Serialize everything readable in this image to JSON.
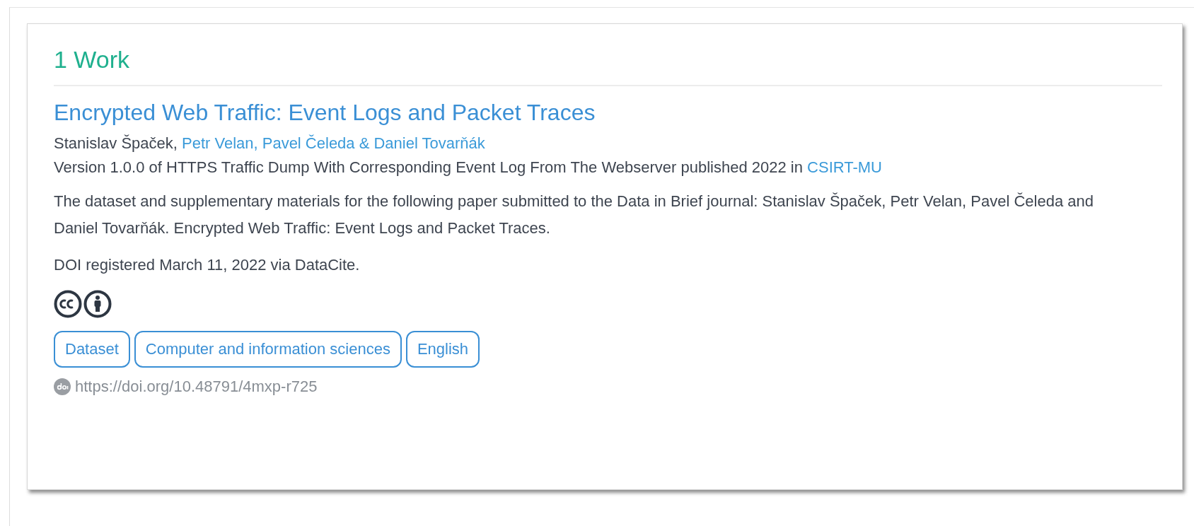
{
  "results_heading": "1 Work",
  "work": {
    "title": "Encrypted Web Traffic: Event Logs and Packet Traces",
    "authors_plain": "Stanislav Špaček,",
    "authors_link": "Petr Velan, Pavel Čeleda & Daniel Tovarňák",
    "version_text": "Version 1.0.0 of HTTPS Traffic Dump With Corresponding Event Log From The Webserver published 2022 in",
    "publisher_link": "CSIRT-MU",
    "description": "The dataset and supplementary materials for the following paper submitted to the Data in Brief journal: Stanislav Špaček, Petr Velan, Pavel Čeleda and Daniel Tovarňák. Encrypted Web Traffic: Event Logs and Packet Traces.",
    "registered": "DOI registered March 11, 2022 via DataCite.",
    "license_icons": [
      {
        "kind": "cc"
      },
      {
        "kind": "by"
      }
    ],
    "tags": [
      "Dataset",
      "Computer and information sciences",
      "English"
    ],
    "doi": "https://doi.org/10.48791/4mxp-r725"
  }
}
